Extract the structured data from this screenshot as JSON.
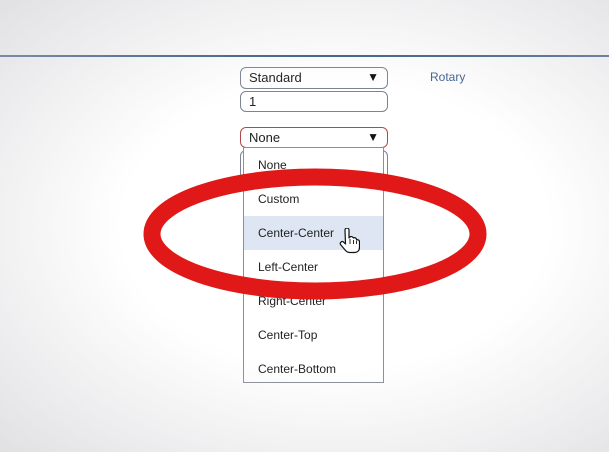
{
  "form": {
    "type_select_value": "Standard",
    "quantity_value": "1",
    "position_select_value": "None",
    "rotary_label": "Rotary"
  },
  "dropdown": {
    "items": [
      {
        "label": "None"
      },
      {
        "label": "Custom"
      },
      {
        "label": "Center-Center"
      },
      {
        "label": "Left-Center"
      },
      {
        "label": "Right-Center"
      },
      {
        "label": "Center-Top"
      },
      {
        "label": "Center-Bottom"
      }
    ],
    "highlighted_index": 2
  },
  "icons": {
    "select_arrow": "triangle-down-icon",
    "cursor": "hand-pointer-icon"
  },
  "colors": {
    "header_rule": "#3f5f86",
    "annotation": "#e01818",
    "highlight": "#dde6f2",
    "link_text": "#3a5f8f"
  }
}
